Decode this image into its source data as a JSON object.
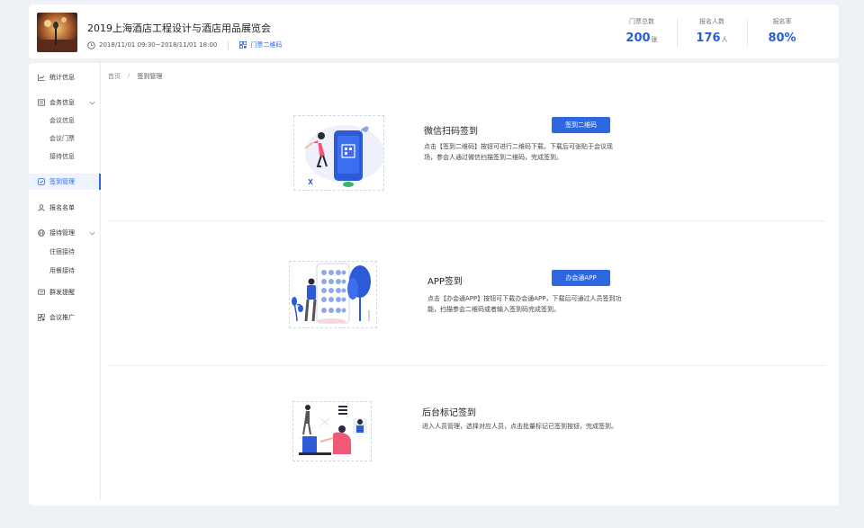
{
  "event": {
    "title": "2019上海酒店工程设计与酒店用品展览会",
    "time": "2018/11/01 09:30~2018/11/01 18:00",
    "qr_link": "门票二维码"
  },
  "stats": [
    {
      "label": "门票总数",
      "value": "200",
      "unit": "张"
    },
    {
      "label": "报名人数",
      "value": "176",
      "unit": "人"
    },
    {
      "label": "报名率",
      "value": "80%",
      "unit": ""
    }
  ],
  "sidebar": {
    "stats": "统计信息",
    "meeting": "会务信息",
    "meeting_info": "会议信息",
    "meeting_ticket": "会议门票",
    "reception_info": "接待信息",
    "checkin": "签到管理",
    "signup_list": "报名名单",
    "reception_mgmt": "接待管理",
    "lodging": "住宿接待",
    "dining": "用餐接待",
    "broadcast": "群发提醒",
    "promotion": "会议推广"
  },
  "breadcrumb": {
    "home": "首页",
    "current": "签到管理"
  },
  "sections": {
    "wechat": {
      "title": "微信扫码签到",
      "desc": "点击【签到二维码】按钮可进行二维码下载。下载后可张贴于会议现场，参会人通过微信扫描签到二维码，完成签到。",
      "button": "签到二维码"
    },
    "app": {
      "title": "APP签到",
      "desc": "点击【办会通APP】按钮可下载办会通APP，下载后可通过人员签到功能，扫描参会二维码或者输入签到码完成签到。",
      "button": "办会通APP"
    },
    "backend": {
      "title": "后台标记签到",
      "desc": "进入人员管理，选择对应人员，点击批量标记已签到按钮，完成签到。"
    }
  },
  "colors": {
    "accent": "#2f67e0",
    "background": "#eef1f5"
  }
}
